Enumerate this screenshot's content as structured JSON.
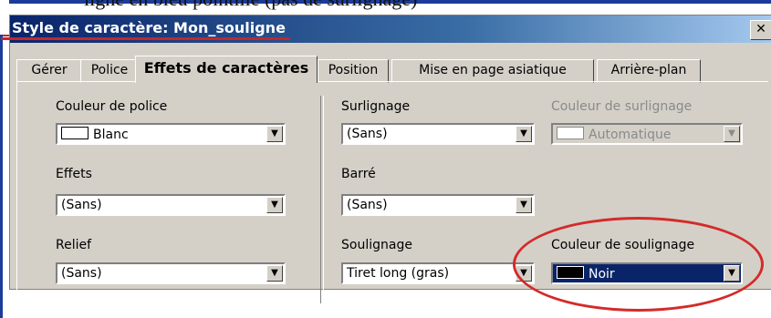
{
  "doc_text": "ligne en bleu pointillé (pas de surlignage)",
  "dialog": {
    "title": "Style de caractère: Mon_souligne",
    "close": "✕"
  },
  "tabs": [
    "Gérer",
    "Police",
    "Effets de caractères",
    "Position",
    "Mise en page asiatique",
    "Arrière-plan"
  ],
  "active_tab": "Effets de caractères",
  "fields": {
    "couleur_police": {
      "label": "Couleur de police",
      "value": "Blanc",
      "swatch": "#ffffff"
    },
    "effets": {
      "label": "Effets",
      "value": "(Sans)"
    },
    "relief": {
      "label": "Relief",
      "value": "(Sans)"
    },
    "surlignage": {
      "label": "Surlignage",
      "value": "(Sans)"
    },
    "barre": {
      "label": "Barré",
      "value": "(Sans)"
    },
    "soulignage": {
      "label": "Soulignage",
      "value": "Tiret long (gras)"
    },
    "couleur_surlignage": {
      "label": "Couleur de surlignage",
      "value": "Automatique",
      "swatch": "#ffffff",
      "disabled": true
    },
    "couleur_soulignage": {
      "label": "Couleur de soulignage",
      "value": "Noir",
      "swatch": "#000000",
      "selected": true
    }
  },
  "colors": {
    "annotation": "#d42a2a",
    "titlebar": "#0a246a",
    "doc_accent": "#1b3c9a"
  }
}
